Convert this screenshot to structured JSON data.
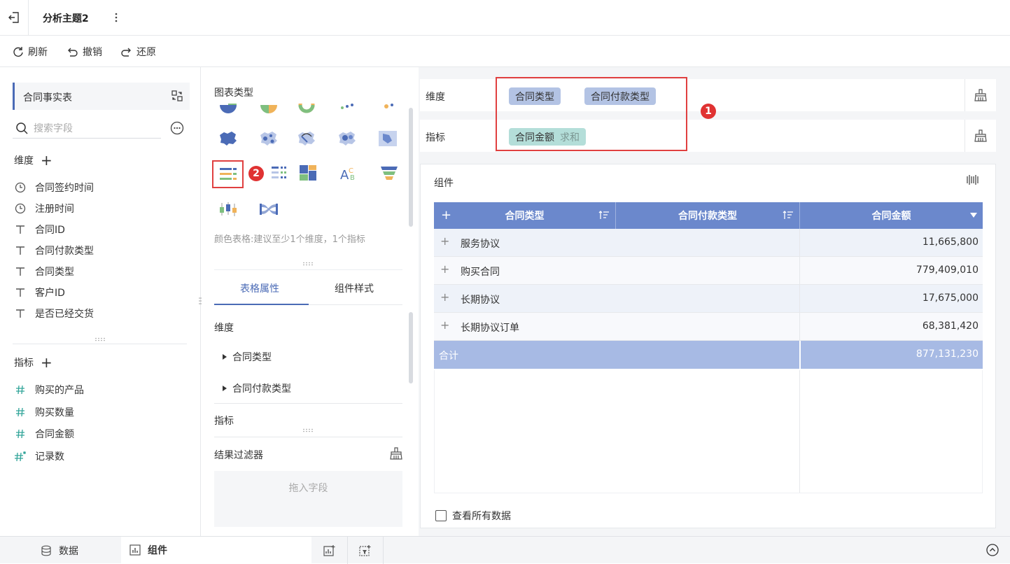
{
  "header": {
    "title": "分析主题2",
    "back_icon": "exit-icon",
    "more_icon": "vertical-dots-icon"
  },
  "toolbar": {
    "refresh": "刷新",
    "undo": "撤销",
    "restore": "还原"
  },
  "left_panel": {
    "dataset_name": "合同事实表",
    "search_placeholder": "搜索字段",
    "dimensions_title": "维度",
    "dimensions": [
      {
        "label": "合同签约时间",
        "icon": "clock-icon"
      },
      {
        "label": "注册时间",
        "icon": "clock-icon"
      },
      {
        "label": "合同ID",
        "icon": "text-type-icon"
      },
      {
        "label": "合同付款类型",
        "icon": "text-type-icon"
      },
      {
        "label": "合同类型",
        "icon": "text-type-icon"
      },
      {
        "label": "客户ID",
        "icon": "text-type-icon"
      },
      {
        "label": "是否已经交货",
        "icon": "text-type-icon"
      }
    ],
    "measures_title": "指标",
    "measures": [
      {
        "label": "购买的产品",
        "icon": "hash-icon"
      },
      {
        "label": "购买数量",
        "icon": "hash-icon"
      },
      {
        "label": "合同金额",
        "icon": "hash-icon"
      },
      {
        "label": "记录数",
        "icon": "hash-star-icon"
      }
    ]
  },
  "middle_panel": {
    "chart_type_label": "图表类型",
    "chart_hint": "颜色表格:建议至少1个维度，1个指标",
    "badge_2": "2",
    "tabs": [
      "表格属性",
      "组件样式"
    ],
    "active_tab": "表格属性",
    "props": {
      "dimension_label": "维度",
      "dimension_items": [
        "合同类型",
        "合同付款类型"
      ],
      "measure_label": "指标",
      "filter_label": "结果过滤器",
      "filter_placeholder": "拖入字段"
    }
  },
  "right_panel": {
    "shelf_dimension_label": "维度",
    "shelf_dimension_pills": [
      "合同类型",
      "合同付款类型"
    ],
    "shelf_measure_label": "指标",
    "shelf_measure_pill": "合同金额",
    "shelf_measure_agg": "求和",
    "badge_1": "1",
    "widget_title": "组件",
    "table": {
      "headers": [
        "合同类型",
        "合同付款类型",
        "合同金额"
      ],
      "add_symbol": "+",
      "rows": [
        {
          "name": "服务协议",
          "value": "11,665,800"
        },
        {
          "name": "购买合同",
          "value": "779,409,010"
        },
        {
          "name": "长期协议",
          "value": "17,675,000"
        },
        {
          "name": "长期协议订单",
          "value": "68,381,420"
        }
      ],
      "total_label": "合计",
      "total_value": "877,131,230"
    },
    "show_all_label": "查看所有数据"
  },
  "bottom_bar": {
    "data_tab": "数据",
    "widget_tab": "组件"
  },
  "colors": {
    "accent": "#4b6bb6",
    "table_header": "#6b88cc",
    "total_row": "#a7bae4",
    "dimension_pill": "#b3c3e4",
    "measure_pill": "#b4ded9",
    "highlight": "#e04040"
  }
}
